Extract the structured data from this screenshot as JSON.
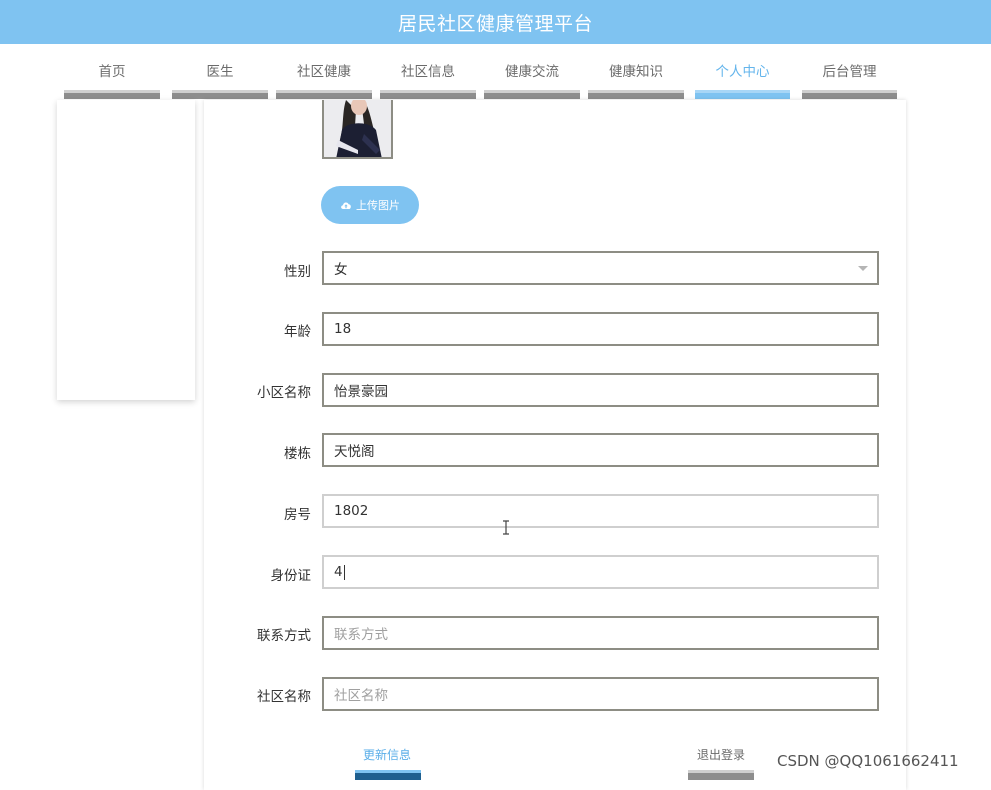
{
  "header": {
    "site_title": "居民社区健康管理平台"
  },
  "nav": {
    "items": [
      {
        "label": "首页"
      },
      {
        "label": "医生"
      },
      {
        "label": "社区健康"
      },
      {
        "label": "社区信息"
      },
      {
        "label": "健康交流"
      },
      {
        "label": "健康知识"
      },
      {
        "label": "个人中心",
        "active": true
      },
      {
        "label": "后台管理"
      }
    ]
  },
  "profile": {
    "upload_label": "上传图片",
    "upload_icon": "cloud-upload-icon",
    "gender": {
      "label": "性别",
      "value": "女"
    },
    "age": {
      "label": "年龄",
      "value": "18"
    },
    "community_estate": {
      "label": "小区名称",
      "value": "怡景豪园"
    },
    "building": {
      "label": "楼栋",
      "value": "天悦阁"
    },
    "room": {
      "label": "房号",
      "value": "1802"
    },
    "id_card": {
      "label": "身份证",
      "value": "4"
    },
    "contact": {
      "label": "联系方式",
      "placeholder": "联系方式"
    },
    "community": {
      "label": "社区名称",
      "placeholder": "社区名称"
    }
  },
  "actions": {
    "update_label": "更新信息",
    "logout_label": "退出登录"
  },
  "watermark": "CSDN @QQ1061662411",
  "colors": {
    "accent": "#7fc3f1",
    "border": "#8d8d84",
    "dark_blue": "#1f5f8f"
  }
}
